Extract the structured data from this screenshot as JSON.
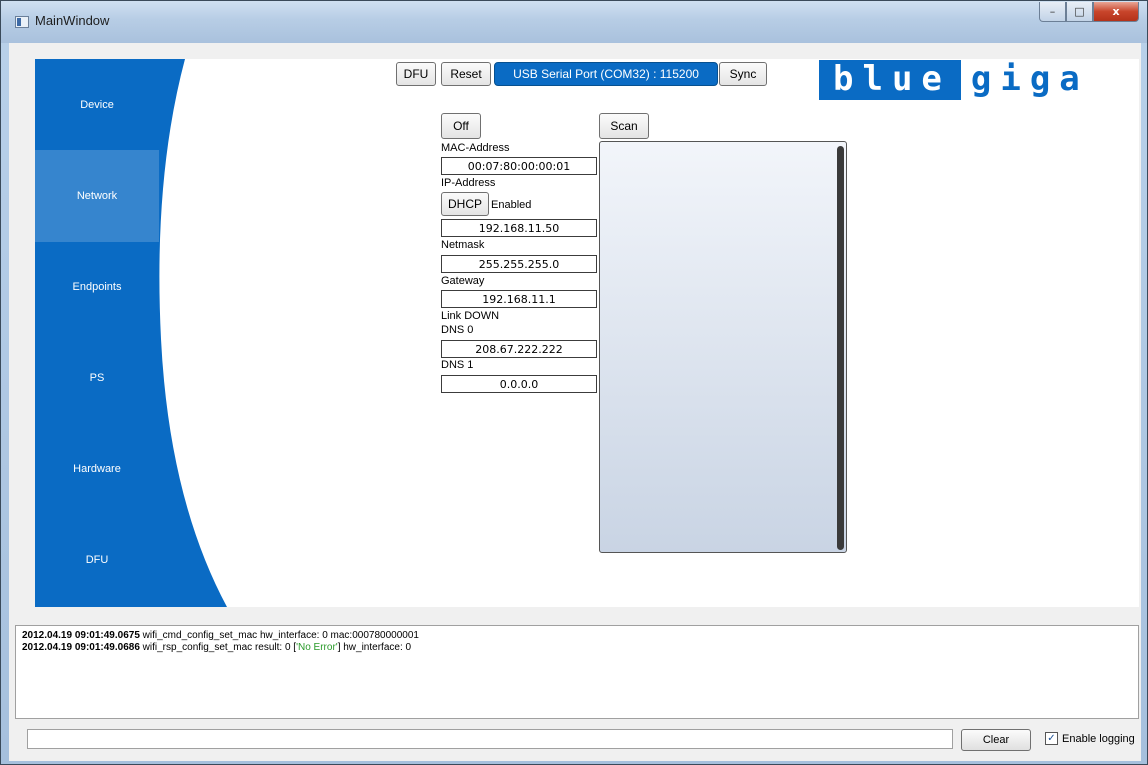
{
  "window": {
    "title": "MainWindow"
  },
  "caption": {
    "minimize": "–",
    "maximize": "□",
    "close": "x"
  },
  "nav": {
    "items": [
      {
        "label": "Device"
      },
      {
        "label": "Network"
      },
      {
        "label": "Endpoints"
      },
      {
        "label": "PS"
      },
      {
        "label": "Hardware"
      },
      {
        "label": "DFU"
      }
    ],
    "active": "Network"
  },
  "toolbar": {
    "dfu_label": "DFU",
    "reset_label": "Reset",
    "port_label": "USB Serial Port (COM32) : 115200",
    "sync_label": "Sync"
  },
  "logo": {
    "part1": "blue",
    "part2": "giga"
  },
  "network": {
    "power_label": "Off",
    "scan_label": "Scan",
    "mac_label": "MAC-Address",
    "mac_value": "00:07:80:00:00:01",
    "ip_label": "IP-Address",
    "dhcp_label": "DHCP",
    "dhcp_status": "Enabled",
    "ip_value": "192.168.11.50",
    "netmask_label": "Netmask",
    "netmask_value": "255.255.255.0",
    "gateway_label": "Gateway",
    "gateway_value": "192.168.11.1",
    "link_status": "Link DOWN",
    "dns0_label": "DNS 0",
    "dns0_value": "208.67.222.222",
    "dns1_label": "DNS 1",
    "dns1_value": "0.0.0.0"
  },
  "log": {
    "lines": [
      {
        "timestamp": "2012.04.19 09:01:49.0675",
        "pre": " wifi_cmd_config_set_mac hw_interface: 0 mac:000780000001",
        "status": "",
        "post": ""
      },
      {
        "timestamp": "2012.04.19 09:01:49.0686",
        "pre": " wifi_rsp_config_set_mac result: 0 [",
        "status": "'No Error'",
        "post": "] hw_interface: 0"
      }
    ]
  },
  "footer": {
    "command_value": "",
    "clear_label": "Clear",
    "logging_label": "Enable logging",
    "logging_checked": true
  },
  "colors": {
    "brand_blue": "#0a6bc4",
    "ok_green": "#2a9a2a"
  }
}
